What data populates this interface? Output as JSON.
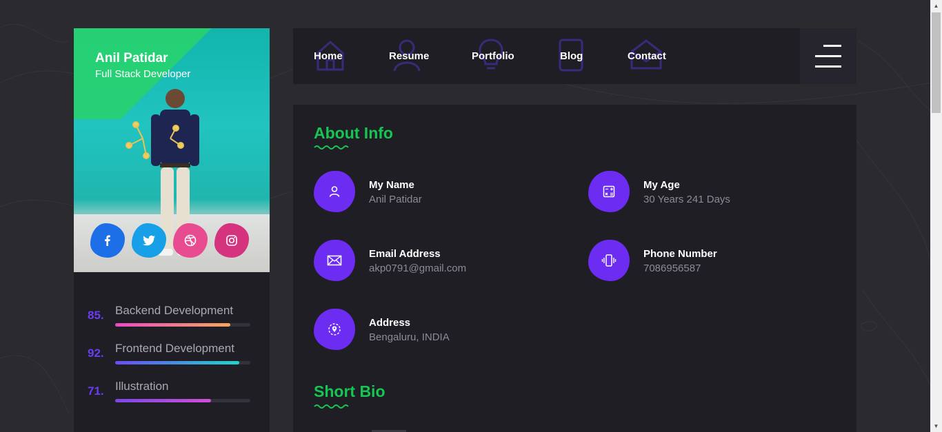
{
  "profile": {
    "name": "Anil Patidar",
    "role": "Full Stack Developer",
    "socials": [
      {
        "icon": "facebook-icon",
        "glyph": "f",
        "color": "#1c6fe6"
      },
      {
        "icon": "twitter-icon",
        "glyph": "t",
        "color": "#17a0e8"
      },
      {
        "icon": "dribbble-icon",
        "glyph": "d",
        "color": "#e84b90"
      },
      {
        "icon": "instagram-icon",
        "glyph": "i",
        "color": "#d6337f"
      }
    ]
  },
  "skills": [
    {
      "pct": "85.",
      "label": "Backend Development",
      "value": 0.85,
      "gradient": [
        "#e94ac6",
        "#f6a75b"
      ]
    },
    {
      "pct": "92.",
      "label": "Frontend Development",
      "value": 0.92,
      "gradient": [
        "#6a4df5",
        "#22d3c9"
      ]
    },
    {
      "pct": "71.",
      "label": "Illustration",
      "value": 0.71,
      "gradient": [
        "#7a47e6",
        "#d14fd8"
      ]
    }
  ],
  "nav": {
    "items": [
      {
        "label": "Home",
        "icon": "home-icon"
      },
      {
        "label": "Resume",
        "icon": "user-icon"
      },
      {
        "label": "Portfolio",
        "icon": "bulb-icon"
      },
      {
        "label": "Blog",
        "icon": "tablet-icon"
      },
      {
        "label": "Contact",
        "icon": "mail-icon"
      }
    ],
    "menu_icon": "hamburger-icon"
  },
  "about": {
    "title": "About Info",
    "items": [
      {
        "title": "My Name",
        "value": "Anil Patidar",
        "icon": "user-icon"
      },
      {
        "title": "My Age",
        "value": "30 Years 241 Days",
        "icon": "calculator-icon"
      },
      {
        "title": "Email Address",
        "value": "akp0791@gmail.com",
        "icon": "envelope-icon"
      },
      {
        "title": "Phone Number",
        "value": "7086956587",
        "icon": "phone-vibrate-icon"
      },
      {
        "title": "Address",
        "value": "Bengaluru, INDIA",
        "icon": "location-pin-icon"
      }
    ]
  },
  "bio": {
    "title": "Short Bio"
  },
  "colors": {
    "accent_green": "#16c653",
    "accent_purple": "#6c2cf1",
    "panel": "#1f1e25",
    "background": "#2a2a2f"
  }
}
